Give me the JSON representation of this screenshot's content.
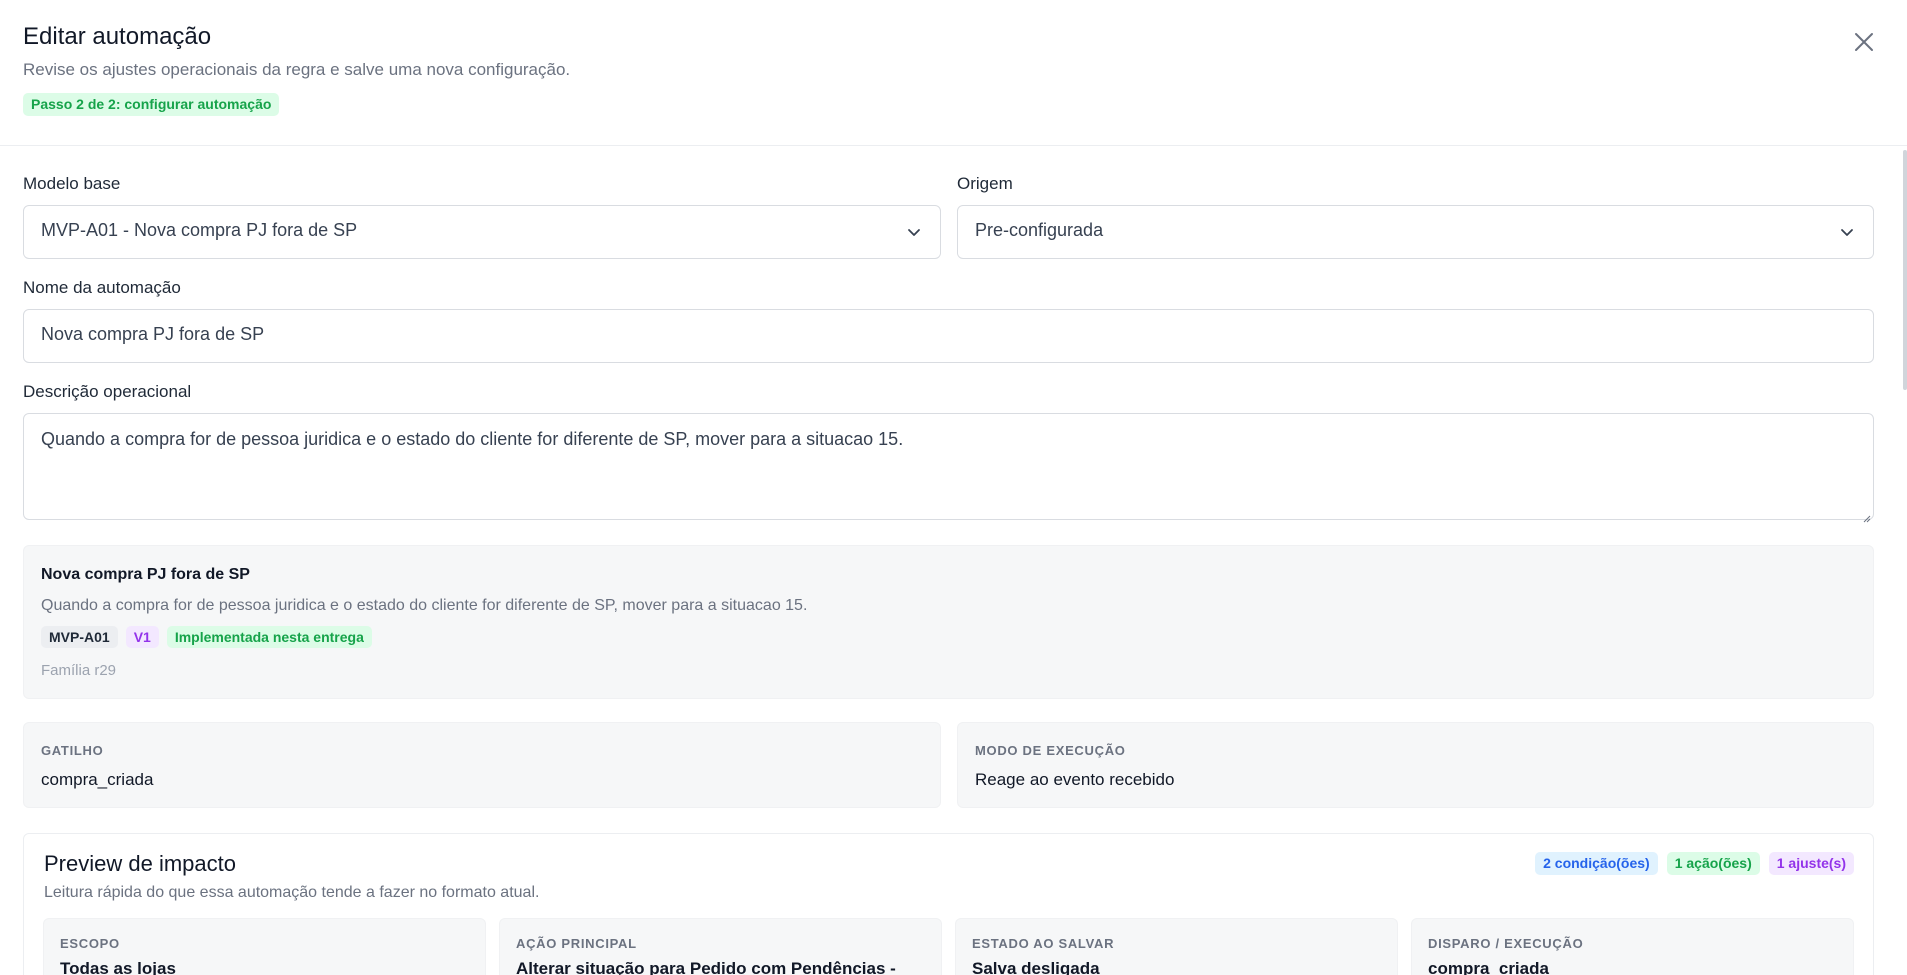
{
  "dialog": {
    "title": "Editar automação",
    "subtitle": "Revise os ajustes operacionais da regra e salve uma nova configuração.",
    "step_badge": "Passo 2 de 2: configurar automação",
    "close_icon": "close-icon"
  },
  "form": {
    "modelo_base": {
      "label": "Modelo base",
      "value": "MVP-A01 - Nova compra PJ fora de SP"
    },
    "origem": {
      "label": "Origem",
      "value": "Pre-configurada"
    },
    "nome": {
      "label": "Nome da automação",
      "value": "Nova compra PJ fora de SP"
    },
    "descricao": {
      "label": "Descrição operacional",
      "value": "Quando a compra for de pessoa juridica e o estado do cliente for diferente de SP, mover para a situacao 15."
    }
  },
  "summary": {
    "title": "Nova compra PJ fora de SP",
    "description": "Quando a compra for de pessoa juridica e o estado do cliente for diferente de SP, mover para a situacao 15.",
    "tags": {
      "code": "MVP-A01",
      "version": "V1",
      "status": "Implementada nesta entrega"
    },
    "family": "Família r29"
  },
  "info": {
    "gatilho": {
      "label": "GATILHO",
      "value": "compra_criada"
    },
    "modo": {
      "label": "MODO DE EXECUÇÃO",
      "value": "Reage ao evento recebido"
    }
  },
  "preview": {
    "title": "Preview de impacto",
    "subtitle": "Leitura rápida do que essa automação tende a fazer no formato atual.",
    "badges": {
      "conditions": "2 condição(ões)",
      "actions": "1 ação(ões)",
      "adjustments": "1 ajuste(s)"
    },
    "cards": [
      {
        "label": "ESCOPO",
        "value": "Todas as lojas"
      },
      {
        "label": "AÇÃO PRINCIPAL",
        "value": "Alterar situação para Pedido com Pendências -"
      },
      {
        "label": "ESTADO AO SALVAR",
        "value": "Salva desligada"
      },
      {
        "label": "DISPARO / EXECUÇÃO",
        "value": "compra_criada"
      }
    ]
  },
  "colors": {
    "accent_green": "#16a34a",
    "accent_blue": "#2563eb",
    "accent_purple": "#9333ea"
  }
}
